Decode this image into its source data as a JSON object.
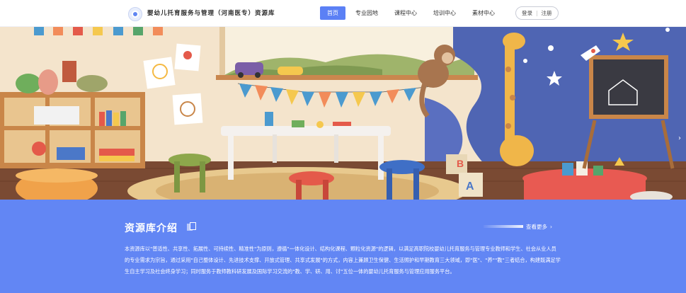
{
  "header": {
    "site_title": "婴幼儿托育服务与管理（河南医专）资源库",
    "nav": [
      {
        "label": "首页",
        "active": true
      },
      {
        "label": "专业园地",
        "active": false
      },
      {
        "label": "课程中心",
        "active": false
      },
      {
        "label": "培训中心",
        "active": false
      },
      {
        "label": "素材中心",
        "active": false
      }
    ],
    "login_label": "登录",
    "register_label": "注册"
  },
  "banner": {
    "blocks_letters": [
      "B",
      "A"
    ],
    "carousel_count": 3,
    "carousel_active": 1
  },
  "intro": {
    "title": "资源库介绍",
    "more_label": "查看更多",
    "body": "本资源库以\"普适性、共享性、拓展性、可持续性、精准性\"为原则，遵循\"一体化设计、结构化课程、颗粒化资源\"的逻辑，以满足高职院校婴幼儿托育服务与管理专业教师和学生、社会从业人员的专业需求为宗旨，通过采用\"自己整体设计、先进技术支撑、开放式管理、共享式发展\"的方式，内容上兼顾卫生保健、生活照护和早期教育三大领域，即\"医\"、\"养\"\"教\"三者结合，构建既满足学生自主学习及社会终身学习；同时服务于教师教科研发展及国际学习交流的\"教、学、研、用、讨\"五位一体的婴幼儿托育服务与管理应用服务平台。"
  },
  "colors": {
    "accent": "#5b80f5",
    "intro_bg": "#6286f4"
  }
}
